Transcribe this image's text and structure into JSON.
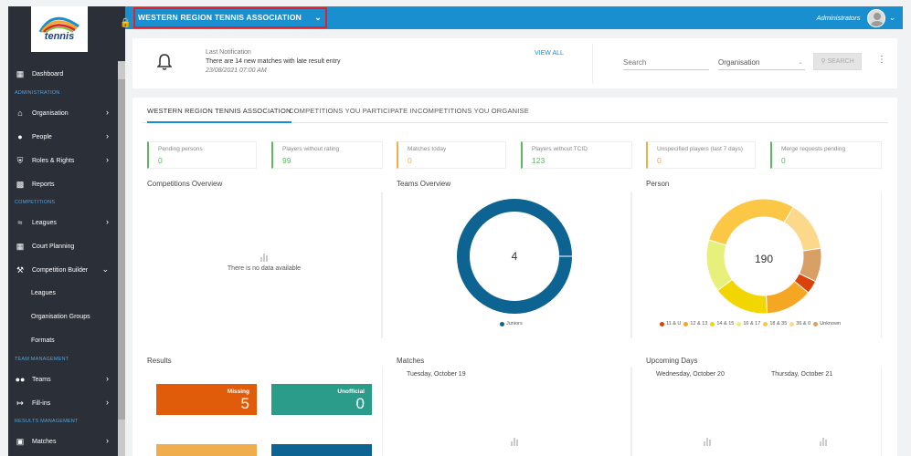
{
  "sidebar": {
    "logo_text": "tennis",
    "items": {
      "dashboard": "Dashboard",
      "sec_admin": "ADMINISTRATION",
      "organisation": "Organisation",
      "people": "People",
      "roles": "Roles & Rights",
      "reports": "Reports",
      "sec_competitions": "COMPETITIONS",
      "leagues": "Leagues",
      "court_planning": "Court Planning",
      "competition_builder": "Competition Builder",
      "sub_leagues": "Leagues",
      "sub_org_groups": "Organisation Groups",
      "sub_formats": "Formats",
      "sec_team": "TEAM MANAGEMENT",
      "teams": "Teams",
      "fill_ins": "Fill-ins",
      "sec_results": "RESULTS MANAGEMENT",
      "matches": "Matches"
    }
  },
  "header": {
    "org_name": "WESTERN REGION TENNIS ASSOCIATION",
    "user_name": "Administrators"
  },
  "notification": {
    "title": "Last Notification",
    "message": "There are 14 new matches with late result entry",
    "time": "23/08/2021 07:00 AM",
    "view_all": "VIEW ALL"
  },
  "search": {
    "placeholder": "Search",
    "org_filter": "Organisation",
    "button": "SEARCH"
  },
  "tabs": [
    "WESTERN REGION TENNIS ASSOCIATION",
    "COMPETITIONS YOU PARTICIPATE IN",
    "COMPETITIONS YOU ORGANISE"
  ],
  "stats": [
    {
      "label": "Pending persons",
      "value": "0"
    },
    {
      "label": "Players without rating",
      "value": "99"
    },
    {
      "label": "Matches today",
      "value": "0"
    },
    {
      "label": "Players without TCID",
      "value": "123"
    },
    {
      "label": "Unspecified players (last 7 days)",
      "value": "0"
    },
    {
      "label": "Merge requests pending",
      "value": "0"
    }
  ],
  "sections": {
    "competitions_overview": "Competitions Overview",
    "no_data": "There is no data available",
    "teams_overview": "Teams Overview",
    "person": "Person",
    "results": "Results",
    "matches": "Matches",
    "upcoming_days": "Upcoming Days"
  },
  "teams_chart": {
    "center": "4",
    "legend": [
      {
        "name": "Juniors",
        "color": "#0d6391"
      }
    ]
  },
  "person_chart": {
    "center": "190",
    "legend": [
      {
        "name": "11 & U",
        "color": "#d9430a"
      },
      {
        "name": "12 & 13",
        "color": "#f5a623"
      },
      {
        "name": "14 & 15",
        "color": "#f2d600"
      },
      {
        "name": "16 & 17",
        "color": "#e7f07a"
      },
      {
        "name": "18 & 35",
        "color": "#fdc746"
      },
      {
        "name": "36 & 0",
        "color": "#fcd98a"
      },
      {
        "name": "Unknown",
        "color": "#d9a066"
      }
    ]
  },
  "chart_data": [
    {
      "type": "pie",
      "title": "Teams Overview",
      "categories": [
        "Juniors"
      ],
      "values": [
        4
      ],
      "colors": [
        "#0d6391"
      ]
    },
    {
      "type": "pie",
      "title": "Person",
      "categories": [
        "Unknown",
        "11 & U",
        "12 & 13",
        "14 & 15",
        "16 & 17",
        "18 & 35",
        "36 & 0"
      ],
      "values": [
        18,
        7,
        25,
        30,
        28,
        55,
        27
      ],
      "colors": [
        "#d9a066",
        "#d9430a",
        "#f5a623",
        "#f2d600",
        "#e7f07a",
        "#fdc746",
        "#fcd98a"
      ]
    }
  ],
  "results": [
    {
      "label": "Missing",
      "value": "5",
      "color": "#e05c0b"
    },
    {
      "label": "Unofficial",
      "value": "0",
      "color": "#2b9b8a"
    }
  ],
  "matches_days": [
    "Tuesday, October 19"
  ],
  "upcoming_days": [
    "Wednesday, October 20",
    "Thursday, October 21"
  ]
}
